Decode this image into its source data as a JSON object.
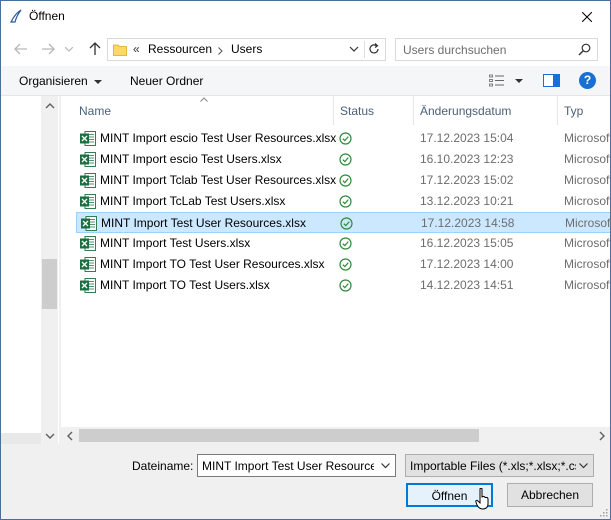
{
  "window": {
    "title": "Öffnen"
  },
  "nav": {
    "breadcrumb_prefix": "«",
    "breadcrumbs": [
      "Ressourcen",
      "Users"
    ],
    "search_placeholder": "Users durchsuchen"
  },
  "toolbar": {
    "organize_label": "Organisieren",
    "new_folder_label": "Neuer Ordner",
    "help_label": "?"
  },
  "columns": {
    "name": "Name",
    "status": "Status",
    "date": "Änderungsdatum",
    "type": "Typ"
  },
  "files": [
    {
      "name": "MINT Import escio Test User Resources.xlsx",
      "date": "17.12.2023 15:04",
      "type": "Microsoft"
    },
    {
      "name": "MINT Import escio Test Users.xlsx",
      "date": "16.10.2023 12:23",
      "type": "Microsoft"
    },
    {
      "name": "MINT Import Tclab Test User Resources.xlsx",
      "date": "17.12.2023 15:02",
      "type": "Microsoft"
    },
    {
      "name": "MINT Import TcLab Test Users.xlsx",
      "date": "13.12.2023 10:21",
      "type": "Microsoft"
    },
    {
      "name": "MINT Import Test User Resources.xlsx",
      "date": "17.12.2023 14:58",
      "type": "Microsoft",
      "selected": true
    },
    {
      "name": "MINT Import Test Users.xlsx",
      "date": "16.12.2023 15:05",
      "type": "Microsoft"
    },
    {
      "name": "MINT Import TO Test User Resources.xlsx",
      "date": "17.12.2023 14:00",
      "type": "Microsoft"
    },
    {
      "name": "MINT Import TO Test Users.xlsx",
      "date": "14.12.2023 14:51",
      "type": "Microsoft"
    }
  ],
  "bottom": {
    "filename_label": "Dateiname:",
    "filename_value": "MINT Import Test User Resources",
    "filetype_value": "Importable Files (*.xls;*.xlsx;*.csv)",
    "open_label": "Öffnen",
    "cancel_label": "Abbrechen"
  },
  "colors": {
    "accent": "#0078d7",
    "selection": "#cce8ff",
    "status_ok": "#2e8b3a",
    "excel": "#1d6f42"
  }
}
